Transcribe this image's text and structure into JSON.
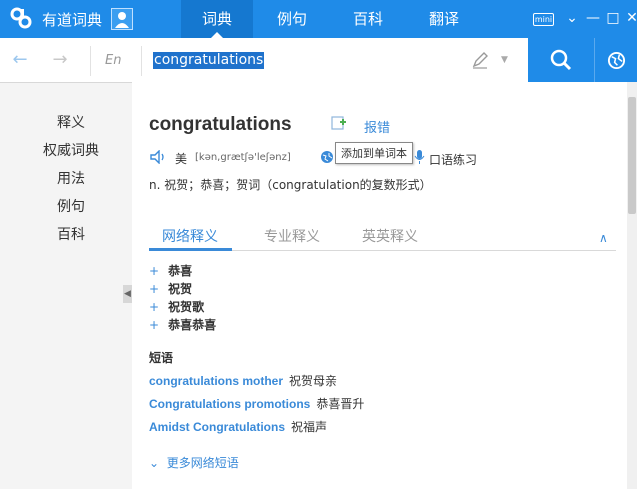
{
  "app": {
    "name": "有道词典",
    "tabs": [
      {
        "label": "词典",
        "active": true
      },
      {
        "label": "例句",
        "active": false
      },
      {
        "label": "百科",
        "active": false
      },
      {
        "label": "翻译",
        "active": false
      }
    ],
    "mini_label": "mini",
    "window_controls": [
      "chevron-down-icon",
      "minimize-icon",
      "maximize-icon",
      "close-icon"
    ]
  },
  "search": {
    "language": "En",
    "query": "congratulations"
  },
  "sidebar": {
    "items": [
      "释义",
      "权威词典",
      "用法",
      "例句",
      "百科"
    ]
  },
  "entry": {
    "headword": "congratulations",
    "report_label": "报错",
    "tooltip": "添加到单词本",
    "pron_label": "美",
    "phonetic": "[kən,grætʃə'leʃənz]",
    "oral_practice": "口语练习",
    "brief_definition": "n. 祝贺；恭喜；贺词（congratulation的复数形式）"
  },
  "def_tabs": [
    {
      "label": "网络释义",
      "active": true
    },
    {
      "label": "专业释义",
      "active": false
    },
    {
      "label": "英英释义",
      "active": false
    }
  ],
  "web_definitions": [
    "恭喜",
    "祝贺",
    "祝贺歌",
    "恭喜恭喜"
  ],
  "phrases": {
    "heading": "短语",
    "items": [
      {
        "en": "congratulations mother",
        "cn": "祝贺母亲"
      },
      {
        "en": "Congratulations promotions",
        "cn": "恭喜晋升"
      },
      {
        "en": "Amidst Congratulations",
        "cn": "祝福声"
      }
    ],
    "more_label": "更多网络短语"
  },
  "colors": {
    "brand": "#1f8be8",
    "link": "#3a8ad8"
  }
}
